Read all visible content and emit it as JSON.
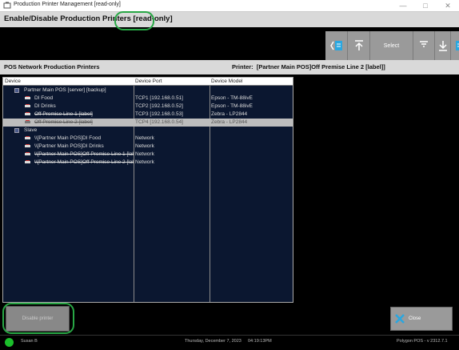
{
  "window": {
    "title": "Production Printer Management [read-only]"
  },
  "header": {
    "title": "Enable/Disable Production Printers",
    "mode": "[read-only]"
  },
  "toolbar": {
    "select_label": "Select"
  },
  "info": {
    "left": "POS Network Production Printers",
    "printer_label": "Printer:",
    "printer_value": "[Partner Main POS]Off Premise Line 2  [label]]"
  },
  "grid": {
    "columns": [
      "Device",
      "Device Port",
      "Device Model"
    ],
    "groups": [
      {
        "label": "Partner Main POS [server] [backup]"
      },
      {
        "label": "Slave"
      }
    ],
    "rows": [
      {
        "device": "DI Food",
        "port": "TCP1  [192.168.0.51]",
        "model": "Epson - TM-88ivE"
      },
      {
        "device": "DI Drinks",
        "port": "TCP2  [192.168.0.52]",
        "model": "Epson - TM-88ivE"
      },
      {
        "device": "Off Premise Line 1  [label]",
        "port": "TCP3  [192.168.0.53]",
        "model": "Zebra - LP2844"
      },
      {
        "device": "Off Premise Line 2  [label]",
        "port": "TCP4  [192.168.0.54]",
        "model": "Zebra - LP2844"
      },
      {
        "device": "\\\\[Partner Main POS]DI Food",
        "port": "Network",
        "model": ""
      },
      {
        "device": "\\\\[Partner Main POS]DI Drinks",
        "port": "Network",
        "model": ""
      },
      {
        "device": "\\\\[Partner Main POS]Off Premise Line 1  [lab",
        "port": "Network",
        "model": ""
      },
      {
        "device": "\\\\[Partner Main POS]Off Premise Line 2  [lab",
        "port": "Network",
        "model": ""
      }
    ]
  },
  "buttons": {
    "enable": "Disable printer",
    "close": "Close"
  },
  "status": {
    "user": "Susan B",
    "date": "Thursday, December  7, 2023",
    "time": "04:19:13PM",
    "version": "Polygon POS - v 2312.7.1"
  },
  "colors": {
    "accent_highlight": "#28a745",
    "status_ok": "#1bbf2b",
    "grid_bg": "#0b1730"
  }
}
